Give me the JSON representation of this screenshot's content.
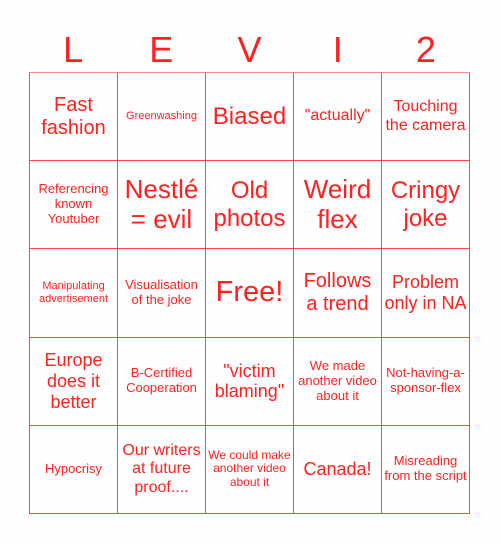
{
  "title": [
    "L",
    "E",
    "V",
    "I",
    "2"
  ],
  "colors": {
    "accent": "#ff2020",
    "border": "#ff4444"
  },
  "cells": [
    [
      "Fast fashion",
      "Greenwashing",
      "Biased",
      "\"actually\"",
      "Touching the camera"
    ],
    [
      "Referencing known Youtuber",
      "Nestlé = evil",
      "Old photos",
      "Weird flex",
      "Cringy joke"
    ],
    [
      "Manipulating advertisement",
      "Visualisation of the joke",
      "Free!",
      "Follows a trend",
      "Problem only in NA"
    ],
    [
      "Europe does it better",
      "B-Certified Cooperation",
      "\"victim blaming\"",
      "We made another video about it",
      "Not-having-a-sponsor-flex"
    ],
    [
      "Hypocrisy",
      "Our writers at future proof....",
      "We could make another video about it",
      "Canada!",
      "Misreading from the script"
    ]
  ]
}
